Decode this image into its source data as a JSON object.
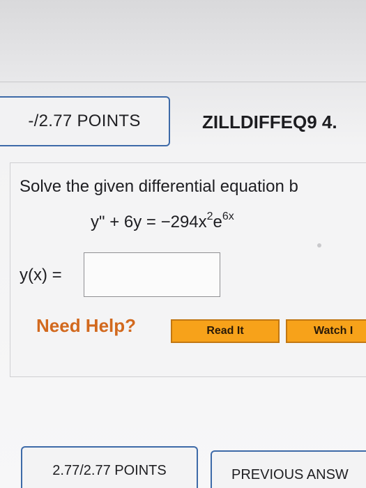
{
  "question": {
    "points_label": "-/2.77 POINTS",
    "problem_id": "ZILLDIFFEQ9 4.",
    "instructions": "Solve the given differential equation b",
    "equation": {
      "lhs": "y\" + 6y = ",
      "coefficient": "−294x",
      "x_exponent": "2",
      "base": "e",
      "e_exponent": "6x"
    },
    "answer_label": "y(x) =",
    "answer_value": ""
  },
  "help": {
    "label": "Need Help?",
    "read_button": "Read It",
    "watch_button": "Watch I"
  },
  "next_question": {
    "points_label": "2.77/2.77 POINTS",
    "previous_answers": "PREVIOUS ANSW"
  },
  "colors": {
    "accent_border": "#3d6aa8",
    "help_text": "#d2691e",
    "button_fill": "#f7a21a"
  }
}
